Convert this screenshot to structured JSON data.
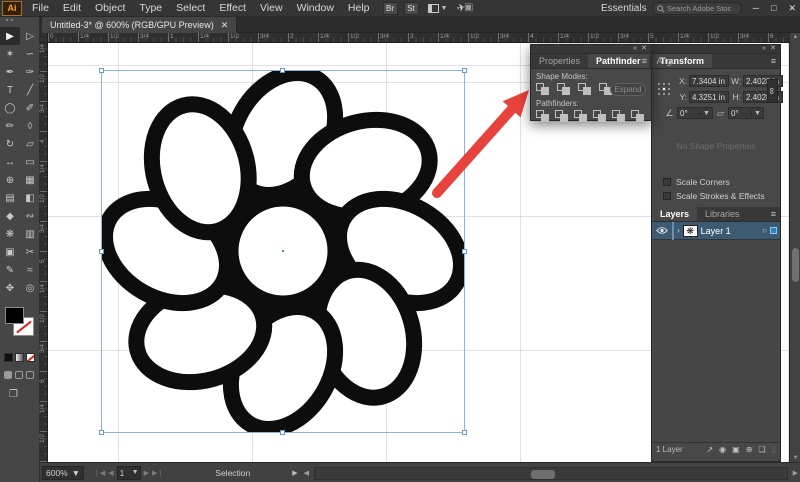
{
  "titlebar": {
    "logo_text": "Ai",
    "menus": [
      "File",
      "Edit",
      "Object",
      "Type",
      "Select",
      "Effect",
      "View",
      "Window",
      "Help"
    ],
    "bridge_button": "Br",
    "stock_button": "St",
    "workspace_name": "Essentials",
    "search_placeholder": "Search Adobe Stock"
  },
  "document_tab": {
    "title": "Untitled-3* @ 600% (RGB/GPU Preview)"
  },
  "toolbar": {
    "tools": [
      {
        "name": "selection-tool",
        "glyph": "▶",
        "selected": true
      },
      {
        "name": "direct-selection-tool",
        "glyph": "▷"
      },
      {
        "name": "magic-wand-tool",
        "glyph": "✶"
      },
      {
        "name": "lasso-tool",
        "glyph": "∽"
      },
      {
        "name": "pen-tool",
        "glyph": "✒"
      },
      {
        "name": "curvature-tool",
        "glyph": "✑"
      },
      {
        "name": "type-tool",
        "glyph": "T"
      },
      {
        "name": "line-segment-tool",
        "glyph": "╱"
      },
      {
        "name": "ellipse-tool",
        "glyph": "◯"
      },
      {
        "name": "paintbrush-tool",
        "glyph": "✐"
      },
      {
        "name": "pencil-tool",
        "glyph": "✏"
      },
      {
        "name": "eraser-tool",
        "glyph": "◊"
      },
      {
        "name": "rotate-tool",
        "glyph": "↻"
      },
      {
        "name": "scale-tool",
        "glyph": "▱"
      },
      {
        "name": "width-tool",
        "glyph": "↔"
      },
      {
        "name": "free-transform-tool",
        "glyph": "▭"
      },
      {
        "name": "shape-builder-tool",
        "glyph": "⊕"
      },
      {
        "name": "perspective-grid-tool",
        "glyph": "▦"
      },
      {
        "name": "mesh-tool",
        "glyph": "▤"
      },
      {
        "name": "gradient-tool",
        "glyph": "◧"
      },
      {
        "name": "eyedropper-tool",
        "glyph": "◆"
      },
      {
        "name": "blend-tool",
        "glyph": "∾"
      },
      {
        "name": "symbol-sprayer-tool",
        "glyph": "❋"
      },
      {
        "name": "column-graph-tool",
        "glyph": "▥"
      },
      {
        "name": "artboard-tool",
        "glyph": "▣"
      },
      {
        "name": "slice-tool",
        "glyph": "✂"
      },
      {
        "name": "shaper-tool",
        "glyph": "✎"
      },
      {
        "name": "smooth-tool",
        "glyph": "≈"
      },
      {
        "name": "hand-tool",
        "glyph": "✥"
      },
      {
        "name": "zoom-tool",
        "glyph": "◎"
      }
    ]
  },
  "ruler": {
    "h_labels": [
      "0",
      "1/4",
      "1/2",
      "3/4",
      "1",
      "1/4",
      "1/2",
      "3/4",
      "2",
      "1/4",
      "1/2",
      "3/4",
      "3",
      "1/4",
      "1/2",
      "3/4",
      "4",
      "1/4",
      "1/2",
      "3/4",
      "5",
      "1/4",
      "1/2",
      "3/4",
      "6"
    ],
    "v_labels": [
      "1/4",
      "1/2",
      "3/4",
      "4",
      "1/4",
      "1/2",
      "3/4",
      "5",
      "1/4",
      "1/2",
      "3/4",
      "6",
      "1/4",
      "1/2"
    ]
  },
  "pathfinder": {
    "tabs": [
      "Properties",
      "Pathfinder",
      "Align"
    ],
    "active_tab": "Pathfinder",
    "shape_modes_label": "Shape Modes:",
    "pathfinders_label": "Pathfinders:",
    "expand_label": "Expand",
    "shape_modes": [
      "unite",
      "minus-front",
      "intersect",
      "exclude"
    ],
    "pathfinders": [
      "divide",
      "trim",
      "merge",
      "crop",
      "outline",
      "minus-back"
    ]
  },
  "transform": {
    "title": "Transform",
    "x_label": "X:",
    "x_value": "7.3404 in",
    "y_label": "Y:",
    "y_value": "4.3251 in",
    "w_label": "W:",
    "w_value": "2.4028 in",
    "h_label": "H:",
    "h_value": "2.4028 in",
    "rotate_value": "0°",
    "shear_value": "0°",
    "empty_text": "No Shape Properties",
    "scale_corners_label": "Scale Corners",
    "scale_strokes_label": "Scale Strokes & Effects"
  },
  "layers": {
    "tabs": [
      "Layers",
      "Libraries"
    ],
    "active_tab": "Layers",
    "layer_name": "Layer 1",
    "count_text": "1 Layer",
    "bottom_icons": [
      {
        "name": "collect-for-export-icon",
        "glyph": "↗"
      },
      {
        "name": "locate-object-icon",
        "glyph": "◉"
      },
      {
        "name": "clipping-mask-icon",
        "glyph": "▣"
      },
      {
        "name": "new-sublayer-icon",
        "glyph": "⊕"
      },
      {
        "name": "new-layer-icon",
        "glyph": "❏"
      },
      {
        "name": "delete-layer-icon",
        "glyph": "▯",
        "dim": true
      }
    ]
  },
  "statusbar": {
    "zoom": "600%",
    "artboard_number": "1",
    "status": "Selection"
  },
  "colors": {
    "accent_blue": "#2d83c6",
    "selection_blue": "#8ab4e2",
    "annotation_red": "#e8423c",
    "artwork_black": "#0d0d0d"
  }
}
